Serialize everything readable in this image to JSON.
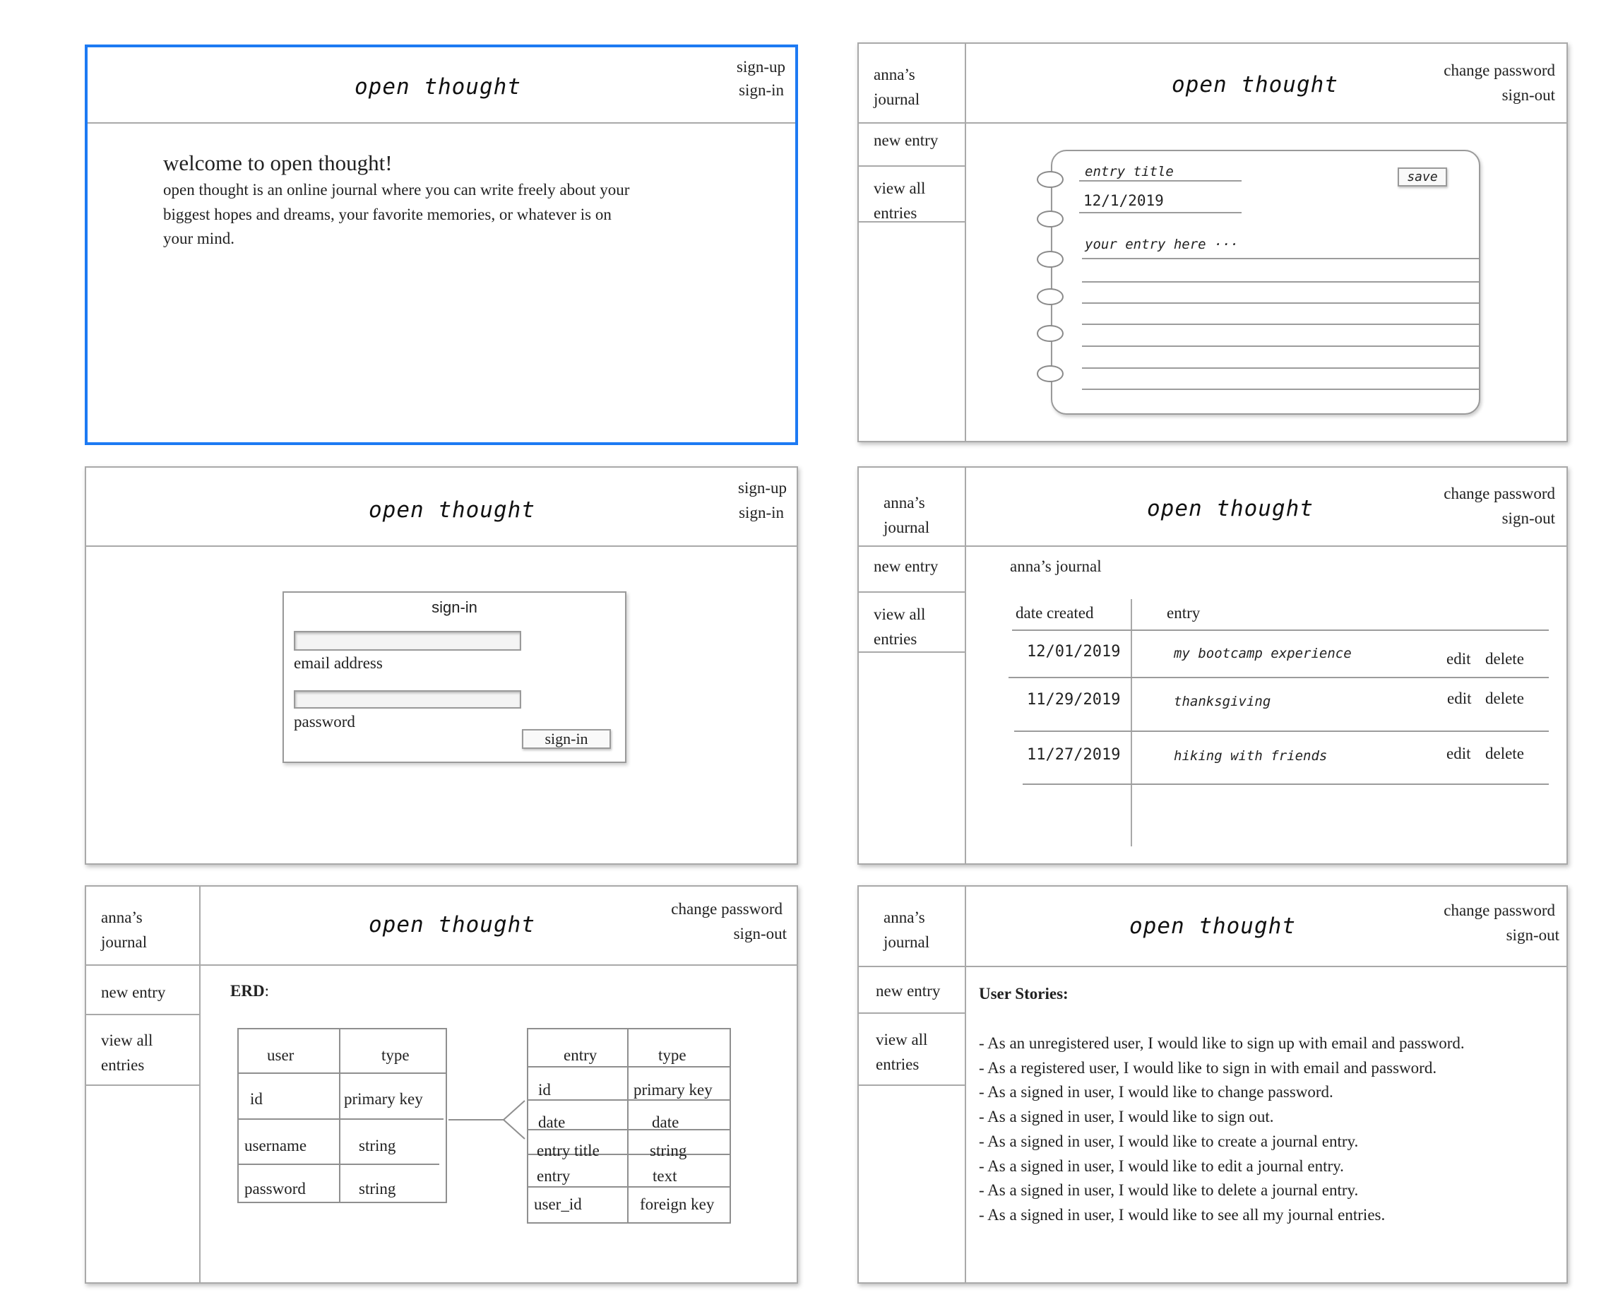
{
  "brand": "open thought",
  "public_nav": {
    "signup": "sign-up",
    "signin": "sign-in"
  },
  "private_nav": {
    "change_password": "change password",
    "signout": "sign-out"
  },
  "sidebar": {
    "journal_line1": "anna’s",
    "journal_line2": "journal",
    "new_entry": "new entry",
    "view_all_line1": "view all",
    "view_all_line2": "entries"
  },
  "welcome": {
    "heading": "welcome to open thought!",
    "lines": [
      "open thought is an online journal where you can write freely about your",
      "biggest hopes and dreams, your favorite memories, or whatever is on",
      "your mind."
    ]
  },
  "new_entry_form": {
    "title_placeholder": "entry title",
    "date": "12/1/2019",
    "save_label": "save",
    "body_placeholder": "your entry here ···"
  },
  "signin_form": {
    "title": "sign-in",
    "email_label": "email address",
    "password_label": "password",
    "button_label": "sign-in"
  },
  "entries_list": {
    "heading": "anna’s journal",
    "col_date": "date created",
    "col_entry": "entry",
    "edit_label": "edit",
    "delete_label": "delete",
    "rows": [
      {
        "date": "12/01/2019",
        "title": "my bootcamp experience"
      },
      {
        "date": "11/29/2019",
        "title": "thanksgiving"
      },
      {
        "date": "11/27/2019",
        "title": "hiking with friends"
      }
    ]
  },
  "erd": {
    "label": "ERD",
    "user_table": {
      "headers": [
        "user",
        "type"
      ],
      "rows": [
        [
          "id",
          "primary key"
        ],
        [
          "username",
          "string"
        ],
        [
          "password",
          "string"
        ]
      ]
    },
    "entry_table": {
      "headers": [
        "entry",
        "type"
      ],
      "rows": [
        [
          "id",
          "primary key"
        ],
        [
          "date",
          "date"
        ],
        [
          "entry title",
          "string"
        ],
        [
          "entry",
          "text"
        ],
        [
          "user_id",
          "foreign key"
        ]
      ]
    }
  },
  "stories": {
    "heading": "User Stories:",
    "items": [
      "- As an unregistered user, I would like to sign up with email and password.",
      "- As a registered user, I would like to sign in with email and password.",
      "- As a signed in user, I would like to change password.",
      "- As a signed in user, I would like to sign out.",
      "- As a signed in user, I would like to create a journal entry.",
      "- As a signed in user, I would like to edit a journal entry.",
      "- As a signed in user, I would like to delete a journal entry.",
      "- As a signed in user, I would like to see all my journal entries."
    ]
  },
  "colors": {
    "selection": "#1d7af3",
    "border": "#a9a9a9"
  }
}
